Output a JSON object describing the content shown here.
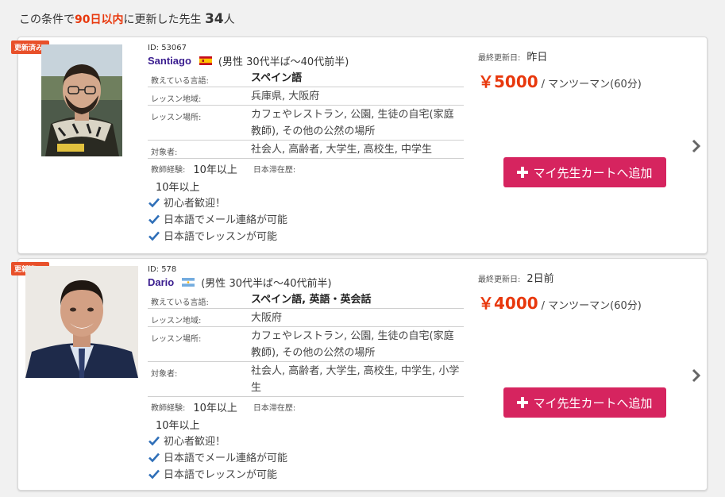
{
  "summary": {
    "prefix": "この条件で",
    "highlight": "90日以内",
    "middle": "に更新した先生",
    "count": "34",
    "suffix": "人"
  },
  "colors": {
    "accent_red": "#e8380d",
    "cart_button": "#d6245f",
    "name_purple": "#3a1d8f",
    "badge": "#e8502a"
  },
  "teachers": [
    {
      "badge": "更新済み!",
      "id": "ID: 53067",
      "name": "Santiago",
      "flag": "spain-flag",
      "gender_age": "(男性 30代半ば〜40代前半)",
      "rows": [
        {
          "label": "教えている言語:",
          "value": "スペイン語"
        },
        {
          "label": "レッスン地域:",
          "value": "兵庫県, 大阪府"
        },
        {
          "label": "レッスン場所:",
          "value": "カフェやレストラン, 公園, 生徒の自宅(家庭教師), その他の公然の場所"
        },
        {
          "label": "対象者:",
          "value": "社会人, 高齢者, 大学生, 高校生, 中学生"
        }
      ],
      "exp_label": "教師経験:",
      "exp_value": "10年以上",
      "japan_label": "日本滞在歴:",
      "japan_value": "10年以上",
      "features": [
        "初心者歓迎！",
        "日本語でメール連絡が可能",
        "日本語でレッスンが可能"
      ],
      "updated_label": "最終更新日:",
      "updated_value": "昨日",
      "price": "￥5000",
      "unit": "/ マンツーマン(60分)",
      "cart_label": "マイ先生カートへ追加"
    },
    {
      "badge": "更新済み!",
      "id": "ID: 578",
      "name": "Dario",
      "flag": "argentina-flag",
      "gender_age": "(男性 30代半ば〜40代前半)",
      "rows": [
        {
          "label": "教えている言語:",
          "value": "スペイン語, 英語・英会話"
        },
        {
          "label": "レッスン地域:",
          "value": "大阪府"
        },
        {
          "label": "レッスン場所:",
          "value": "カフェやレストラン, 公園, 生徒の自宅(家庭教師), その他の公然の場所"
        },
        {
          "label": "対象者:",
          "value": "社会人, 高齢者, 大学生, 高校生, 中学生, 小学生"
        }
      ],
      "exp_label": "教師経験:",
      "exp_value": "10年以上",
      "japan_label": "日本滞在歴:",
      "japan_value": "10年以上",
      "features": [
        "初心者歓迎！",
        "日本語でメール連絡が可能",
        "日本語でレッスンが可能"
      ],
      "updated_label": "最終更新日:",
      "updated_value": "2日前",
      "price": "￥4000",
      "unit": "/ マンツーマン(60分)",
      "cart_label": "マイ先生カートへ追加"
    }
  ]
}
